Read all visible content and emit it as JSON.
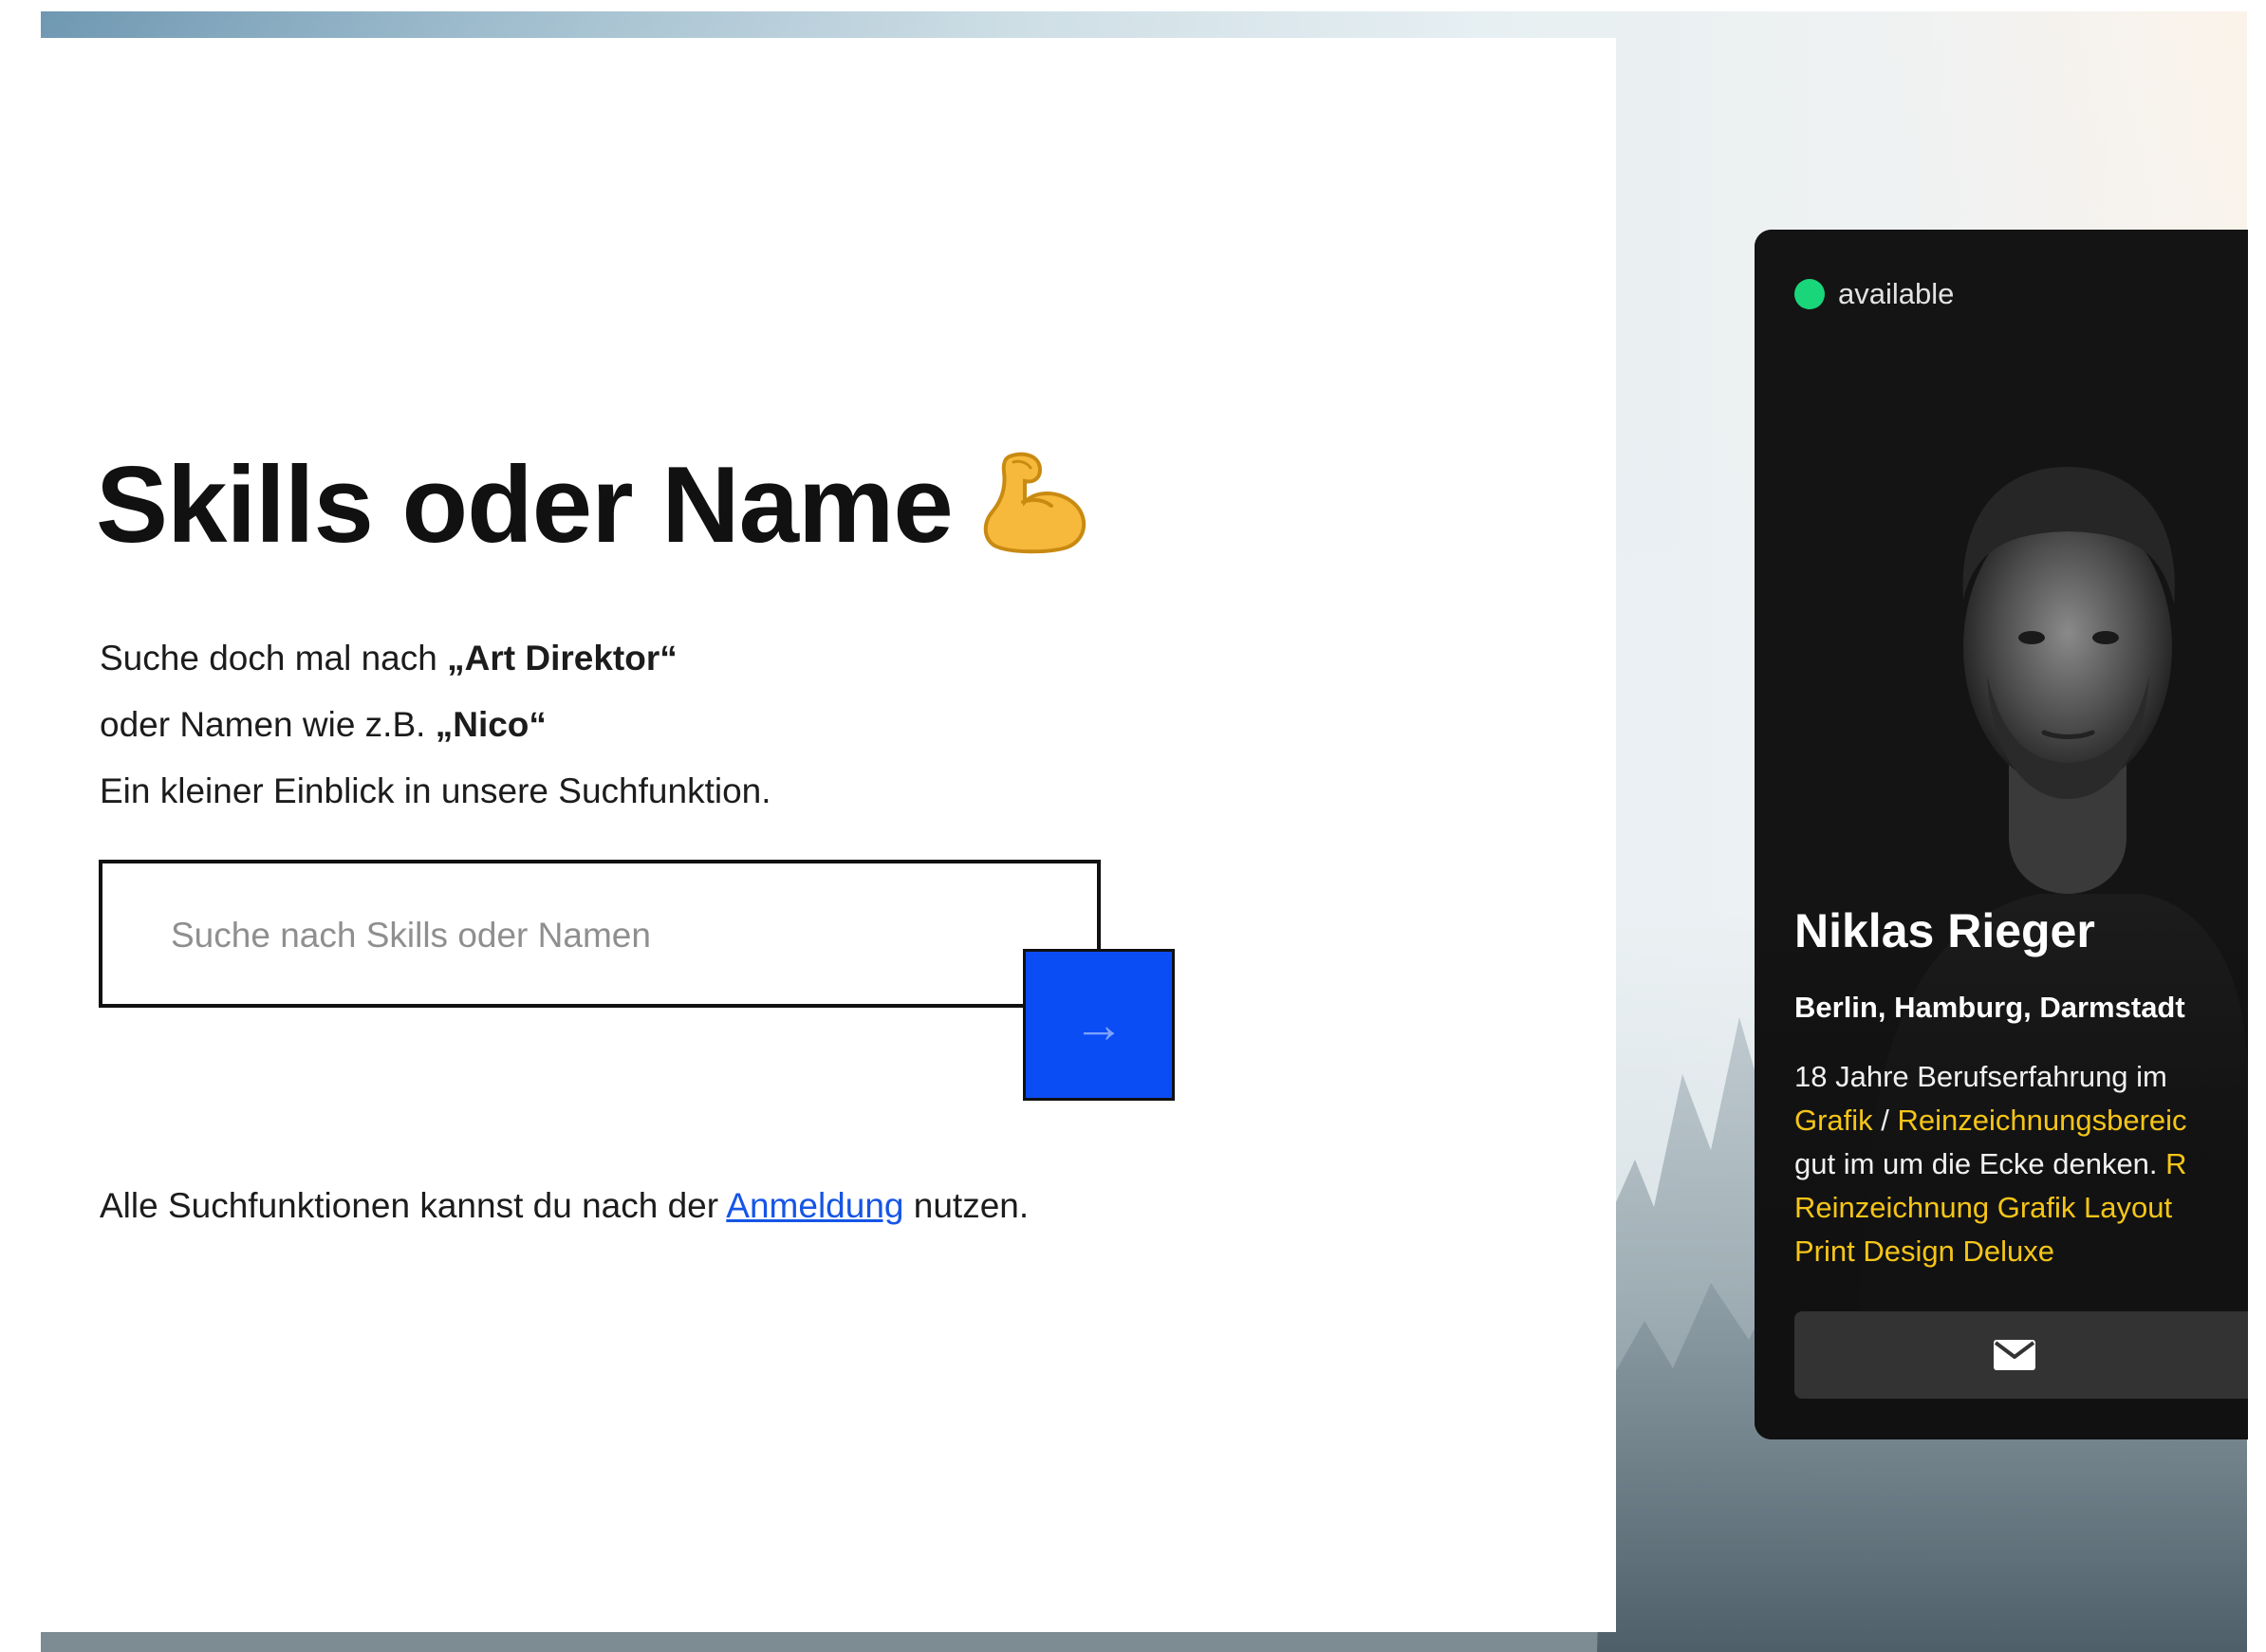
{
  "hero": {
    "title": "Skills oder Name",
    "emoji_icon": "flexed-biceps-icon",
    "hint_prefix_1": "Suche doch mal nach ",
    "hint_quote_1": "„Art Direktor“",
    "hint_prefix_2": "oder Namen wie z.B. ",
    "hint_quote_2": "„Nico“",
    "hint_line_3": "Ein kleiner Einblick in unsere Suchfunktion."
  },
  "search": {
    "placeholder": "Suche nach Skills oder Namen",
    "value": "",
    "button_icon": "arrow-right-icon",
    "button_color": "#0b4df5"
  },
  "login": {
    "prefix": "Alle Suchfunktionen kannst du nach der ",
    "link": "Anmeldung",
    "suffix": " nutzen.",
    "link_color": "#1555e6"
  },
  "profile_card": {
    "status": "available",
    "status_color": "#19d67a",
    "name": "Niklas Rieger",
    "locations": "Berlin, Hamburg, Darmstadt",
    "desc_line_1": "18 Jahre Berufserfahrung im",
    "desc_tag_1": "Grafik",
    "desc_sep": " / ",
    "desc_tag_2": "Reinzeichnungsbereic",
    "desc_line_3": "gut im um die Ecke denken. ",
    "desc_tag_3": "R",
    "desc_tags_line_4": "Reinzeichnung Grafik Layout",
    "desc_tags_line_5": "Print Design Deluxe",
    "tag_color": "#f5c518",
    "contact_icon": "envelope-icon"
  }
}
